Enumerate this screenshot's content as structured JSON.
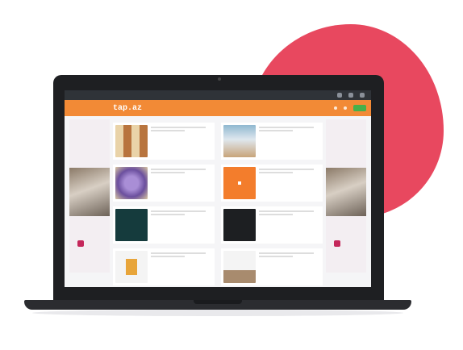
{
  "colors": {
    "blob": "#e8485f",
    "header": "#f28a36",
    "cta": "#46b04a",
    "ad_accent": "#c4275b"
  },
  "header": {
    "logo": "tap.az",
    "tagline": "",
    "actions": [
      "",
      ""
    ],
    "cta": ""
  },
  "section_title": "",
  "ads": {
    "left": {
      "title": "",
      "sub": ""
    },
    "right": {
      "title": "",
      "sub": ""
    }
  },
  "cards": [
    {
      "title": "",
      "desc": "",
      "link": ""
    },
    {
      "title": "",
      "desc": "",
      "link": ""
    },
    {
      "title": "",
      "desc": "",
      "link": ""
    },
    {
      "title": "",
      "desc": "",
      "link": ""
    },
    {
      "title": "",
      "desc": "",
      "link": ""
    },
    {
      "title": "",
      "desc": "",
      "link": ""
    },
    {
      "title": "",
      "desc": "",
      "link": ""
    },
    {
      "title": "",
      "desc": "",
      "link": ""
    }
  ]
}
